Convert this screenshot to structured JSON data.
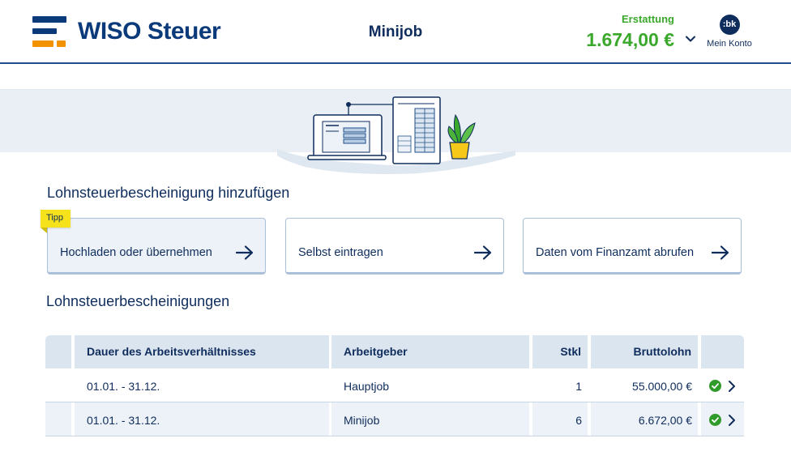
{
  "header": {
    "logo_text": "WISO Steuer",
    "page_title": "Minijob",
    "refund_label": "Erstattung",
    "refund_amount": "1.674,00 €",
    "account_initials": ":bk",
    "account_label": "Mein Konto"
  },
  "add_section": {
    "title": "Lohnsteuerbescheinigung hinzufügen",
    "tip_label": "Tipp",
    "cards": [
      {
        "label": "Hochladen oder übernehmen"
      },
      {
        "label": "Selbst eintragen"
      },
      {
        "label": "Daten vom Finanzamt abrufen"
      }
    ]
  },
  "list_section": {
    "title": "Lohnsteuerbescheinigungen",
    "columns": [
      "Dauer des Arbeitsverhältnisses",
      "Arbeitgeber",
      "Stkl",
      "Bruttolohn"
    ],
    "rows": [
      {
        "duration": "01.01. - 31.12.",
        "employer": "Hauptjob",
        "stkl": "1",
        "gross": "55.000,00 €",
        "status": "check-icon"
      },
      {
        "duration": "01.01. - 31.12.",
        "employer": "Minijob",
        "stkl": "6",
        "gross": "6.672,00 €",
        "status": "check-icon"
      }
    ]
  },
  "colors": {
    "brand_blue": "#0b3a7a",
    "brand_orange": "#f39200",
    "refund_green": "#3aa82a",
    "text_navy": "#0f2d5c",
    "tip_yellow": "#f6e21a",
    "table_header": "#dbe5f0"
  }
}
